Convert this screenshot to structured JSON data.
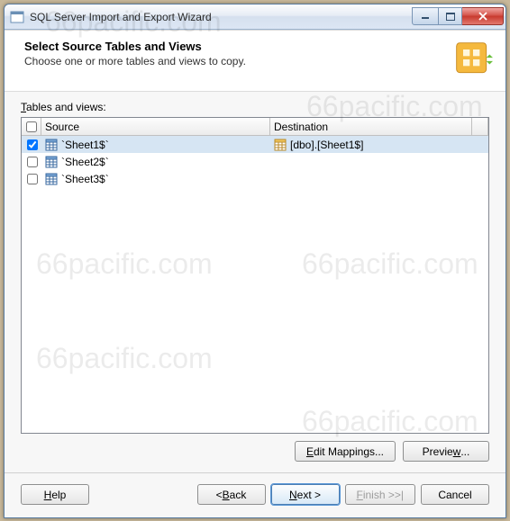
{
  "window": {
    "title": "SQL Server Import and Export Wizard"
  },
  "header": {
    "title": "Select Source Tables and Views",
    "subtitle": "Choose one or more tables and views to copy."
  },
  "grid": {
    "label": "Tables and views:",
    "cols": {
      "source": "Source",
      "destination": "Destination"
    },
    "rows": [
      {
        "checked": true,
        "source": "`Sheet1$`",
        "destination": "[dbo].[Sheet1$]",
        "selected": true
      },
      {
        "checked": false,
        "source": "`Sheet2$`",
        "destination": "",
        "selected": false
      },
      {
        "checked": false,
        "source": "`Sheet3$`",
        "destination": "",
        "selected": false
      }
    ]
  },
  "buttons": {
    "editMappings": "Edit Mappings...",
    "preview": "Preview...",
    "help": "Help",
    "back": "< Back",
    "next": "Next >",
    "finish": "Finish >>|",
    "cancel": "Cancel"
  }
}
